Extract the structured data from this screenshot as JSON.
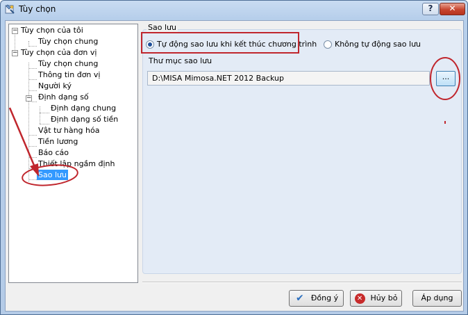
{
  "window": {
    "title": "Tùy chọn",
    "help_label": "?",
    "close_label": "✕",
    "icon": "options-app-icon"
  },
  "tree": {
    "items": [
      {
        "label": "Tùy chọn của tôi",
        "level": 0,
        "expander": "⊟"
      },
      {
        "label": "Tùy chọn chung",
        "level": 1
      },
      {
        "label": "Tùy chọn của đơn vị",
        "level": 0,
        "expander": "⊟"
      },
      {
        "label": "Tùy chọn chung",
        "level": 1
      },
      {
        "label": "Thông tin đơn vị",
        "level": 1
      },
      {
        "label": "Người ký",
        "level": 1
      },
      {
        "label": "Định dạng số",
        "level": 1,
        "expander": "⊟"
      },
      {
        "label": "Định dạng chung",
        "level": 2
      },
      {
        "label": "Định dạng số tiền",
        "level": 2
      },
      {
        "label": "Vật tư hàng hóa",
        "level": 1
      },
      {
        "label": "Tiền lương",
        "level": 1
      },
      {
        "label": "Báo cáo",
        "level": 1
      },
      {
        "label": "Thiết lập ngầm định",
        "level": 1
      },
      {
        "label": "Sao lưu",
        "level": 1,
        "selected": true
      }
    ]
  },
  "backup": {
    "group_title": "Sao lưu",
    "option_auto": "Tự động sao lưu khi kết thúc chương trình",
    "option_manual": "Không tự động sao lưu",
    "selected_option": "auto",
    "folder_label": "Thư mục sao lưu",
    "folder_value": "D:\\MISA Mimosa.NET 2012 Backup",
    "browse_label": "..."
  },
  "buttons": {
    "ok": "Đồng ý",
    "cancel": "Hủy bỏ",
    "apply": "Áp dụng"
  },
  "colors": {
    "annotation": "#c0262d",
    "selection": "#3399ff"
  }
}
